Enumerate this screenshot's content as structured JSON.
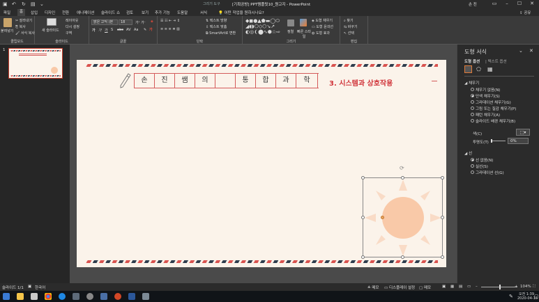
{
  "titlebar": {
    "context_label": "그리기 도구",
    "title": "[기획공방] PPT템플릿10_원고지 - PowerPoint",
    "user": "손 진",
    "min": "–",
    "max": "☐",
    "close": "✕"
  },
  "tabs": [
    "파일",
    "홈",
    "삽입",
    "디자인",
    "전환",
    "애니메이션",
    "슬라이드 쇼",
    "검토",
    "보기",
    "추가 기능",
    "도움말",
    "서식"
  ],
  "tell_me": "어떤 작업을 원하시나요?",
  "share": "공유",
  "ribbon": {
    "clipboard": {
      "label": "클립보드",
      "paste": "붙여넣기",
      "cut": "잘라내기",
      "copy": "복사",
      "format": "서식 복사"
    },
    "slides": {
      "label": "슬라이드",
      "new": "새 슬라이드",
      "layout": "레이아웃",
      "reset": "다시 설정",
      "section": "구역"
    },
    "font": {
      "label": "글꼴",
      "name": "맑은 고딕 (본",
      "size": "18"
    },
    "paragraph": {
      "label": "단락",
      "direction": "텍스트 방향",
      "align": "텍스트 맞춤",
      "smartart": "SmartArt로 변환"
    },
    "drawing": {
      "label": "그리기",
      "arrange": "정렬",
      "quick": "빠른 스타일",
      "fill": "도형 채우기",
      "outline": "도형 윤곽선",
      "effect": "도형 효과"
    },
    "editing": {
      "label": "편집",
      "find": "찾기",
      "replace": "바꾸기",
      "select": "선택"
    }
  },
  "thumb_number": "1",
  "slide": {
    "title_chars": [
      "손",
      "진",
      "쌤",
      "의",
      "",
      "통",
      "합",
      "과",
      "학"
    ],
    "subtitle": "3. 시스템과 상호작용"
  },
  "pane": {
    "title": "도형 서식",
    "tab_shape": "도형 옵션",
    "tab_text": "텍스트 옵션",
    "fill_section": "채우기",
    "fill_options": [
      {
        "label": "채우기 없음(N)",
        "on": false
      },
      {
        "label": "단색 채우기(S)",
        "on": true
      },
      {
        "label": "그라데이션 채우기(G)",
        "on": false
      },
      {
        "label": "그림 또는 질감 채우기(P)",
        "on": false
      },
      {
        "label": "패턴 채우기(A)",
        "on": false
      },
      {
        "label": "슬라이드 배경 채우기(B)",
        "on": false
      }
    ],
    "color_label": "색(C)",
    "transparency_label": "투명도(T)",
    "transparency_value": "0%",
    "line_section": "선",
    "line_options": [
      {
        "label": "선 없음(N)",
        "on": true
      },
      {
        "label": "실선(S)",
        "on": false
      },
      {
        "label": "그라데이션 선(G)",
        "on": false
      }
    ]
  },
  "status": {
    "slide": "슬라이드 1/1",
    "lang": "한국어",
    "notes": "메모",
    "display": "디스플레이 설정",
    "comments": "메모",
    "zoom": "104%"
  },
  "taskbar": {
    "time": "오전 1:39",
    "date": "2020-04-15"
  },
  "colors": {
    "accent": "#d0343a",
    "sun": "#f9c9a8",
    "airmail_red": "#d9534f",
    "airmail_navy": "#2f3e4e"
  }
}
